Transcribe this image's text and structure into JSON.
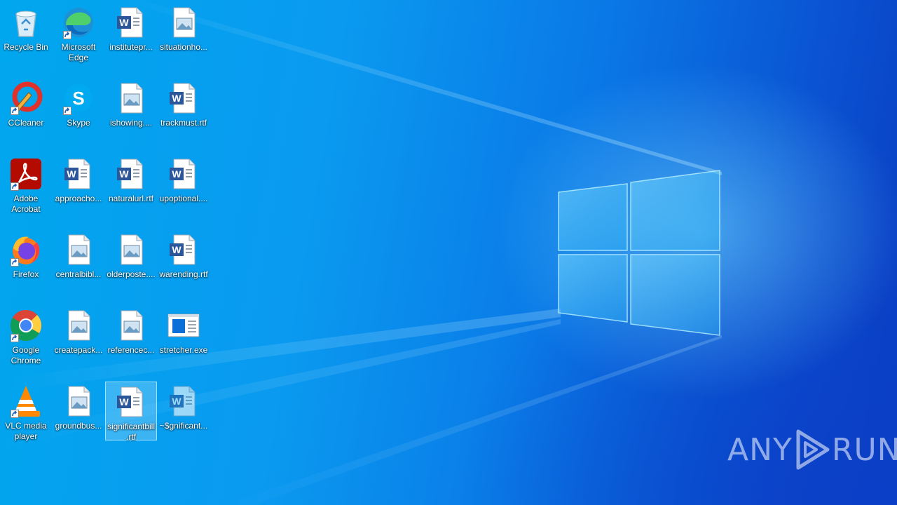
{
  "desktop": {
    "icons": [
      {
        "label": "Recycle Bin",
        "type": "recycle-bin",
        "shortcut": false
      },
      {
        "label": "Microsoft Edge",
        "type": "edge",
        "shortcut": true
      },
      {
        "label": "institutepr...",
        "type": "word-doc",
        "shortcut": false
      },
      {
        "label": "situationho...",
        "type": "image-file",
        "shortcut": false
      },
      {
        "label": "CCleaner",
        "type": "ccleaner",
        "shortcut": true
      },
      {
        "label": "Skype",
        "type": "skype",
        "shortcut": true
      },
      {
        "label": "ishowing....",
        "type": "image-file",
        "shortcut": false
      },
      {
        "label": "trackmust.rtf",
        "type": "word-doc",
        "shortcut": false
      },
      {
        "label": "Adobe Acrobat",
        "type": "acrobat",
        "shortcut": true
      },
      {
        "label": "approacho...",
        "type": "word-doc",
        "shortcut": false
      },
      {
        "label": "naturalurl.rtf",
        "type": "word-doc",
        "shortcut": false
      },
      {
        "label": "upoptional....",
        "type": "word-doc",
        "shortcut": false
      },
      {
        "label": "Firefox",
        "type": "firefox",
        "shortcut": true
      },
      {
        "label": "centralbibl...",
        "type": "image-file",
        "shortcut": false
      },
      {
        "label": "olderposte....",
        "type": "image-file",
        "shortcut": false
      },
      {
        "label": "warending.rtf",
        "type": "word-doc",
        "shortcut": false
      },
      {
        "label": "Google Chrome",
        "type": "chrome",
        "shortcut": true
      },
      {
        "label": "createpack...",
        "type": "image-file",
        "shortcut": false
      },
      {
        "label": "referencec...",
        "type": "image-file",
        "shortcut": false
      },
      {
        "label": "stretcher.exe",
        "type": "exe",
        "shortcut": false
      },
      {
        "label": "VLC media player",
        "type": "vlc",
        "shortcut": true
      },
      {
        "label": "groundbus...",
        "type": "image-file",
        "shortcut": false
      },
      {
        "label": "significantbill.rtf",
        "type": "word-doc",
        "shortcut": false,
        "selected": true
      },
      {
        "label": "~$gnificant...",
        "type": "word-doc-temp",
        "shortcut": false
      }
    ]
  },
  "watermark": {
    "left": "ANY",
    "right": "RUN"
  },
  "colors": {
    "wallpaper": "#0a9af0",
    "word_blue": "#2b579a",
    "selection": "#a0dcff"
  }
}
